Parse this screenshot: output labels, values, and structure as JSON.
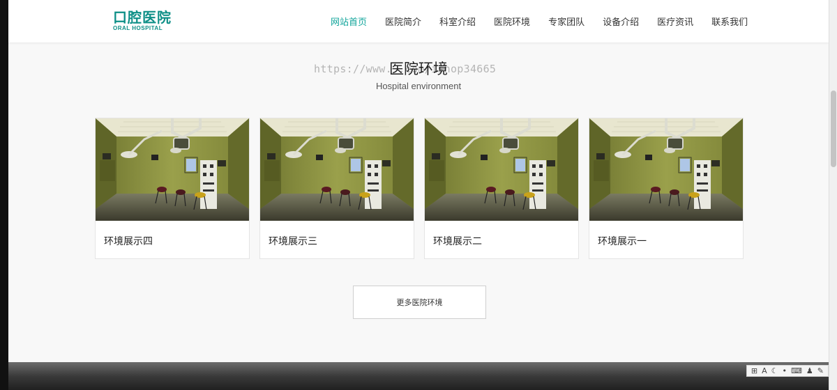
{
  "header": {
    "logo_cn": "口腔医院",
    "logo_en": "ORAL HOSPITAL",
    "nav": [
      {
        "label": "网站首页",
        "active": true
      },
      {
        "label": "医院简介",
        "active": false
      },
      {
        "label": "科室介绍",
        "active": false
      },
      {
        "label": "医院环境",
        "active": false
      },
      {
        "label": "专家团队",
        "active": false
      },
      {
        "label": "设备介绍",
        "active": false
      },
      {
        "label": "医疗资讯",
        "active": false
      },
      {
        "label": "联系我们",
        "active": false
      }
    ]
  },
  "section": {
    "title": "医院环境",
    "subtitle": "Hospital environment",
    "watermark": "https://www.      .com/ishop34665"
  },
  "cards": [
    {
      "label": "环境展示四",
      "image": "operating-room-photo"
    },
    {
      "label": "环境展示三",
      "image": "operating-room-photo"
    },
    {
      "label": "环境展示二",
      "image": "operating-room-photo"
    },
    {
      "label": "环境展示一",
      "image": "operating-room-photo"
    }
  ],
  "more_button": "更多医院环境",
  "toolbar": {
    "icons": [
      "input-method-icon",
      "font-icon",
      "moon-icon",
      "punctuation-icon",
      "keyboard-icon",
      "user-icon",
      "wrench-icon"
    ]
  },
  "colors": {
    "accent": "#12a59b",
    "logo": "#0e8f87"
  }
}
